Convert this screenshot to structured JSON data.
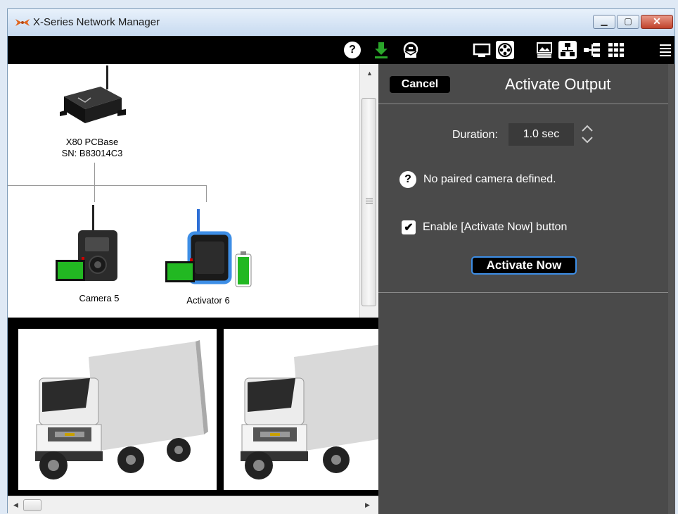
{
  "window": {
    "title": "X-Series Network Manager",
    "min_glyph": "▁",
    "max_glyph": "▢",
    "close_glyph": "✕"
  },
  "toolbar": {
    "help_glyph": "?",
    "icons": [
      "help-icon",
      "download-icon",
      "email-icon",
      "monitor-icon",
      "film-reel-icon",
      "image-list-icon",
      "network-icon",
      "tree-icon",
      "grid-icon",
      "menu-icon"
    ]
  },
  "tree": {
    "base": {
      "line1": "X80 PCBase",
      "line2": "SN: B83014C3"
    },
    "nodes": [
      {
        "label": "Camera 5"
      },
      {
        "label": "Activator 6"
      }
    ]
  },
  "panel": {
    "cancel_label": "Cancel",
    "title": "Activate Output",
    "duration_label": "Duration:",
    "duration_value": "1.0 sec",
    "info_glyph": "?",
    "info_text": "No paired camera defined.",
    "checkbox_glyph": "✔",
    "enable_label": "Enable [Activate Now] button",
    "enable_checked": true,
    "activate_label": "Activate Now"
  },
  "colors": {
    "panel_bg": "#4a4a4a",
    "accent_blue": "#3d8ee6",
    "battery_green": "#22b822",
    "download_green": "#2aa52a"
  }
}
